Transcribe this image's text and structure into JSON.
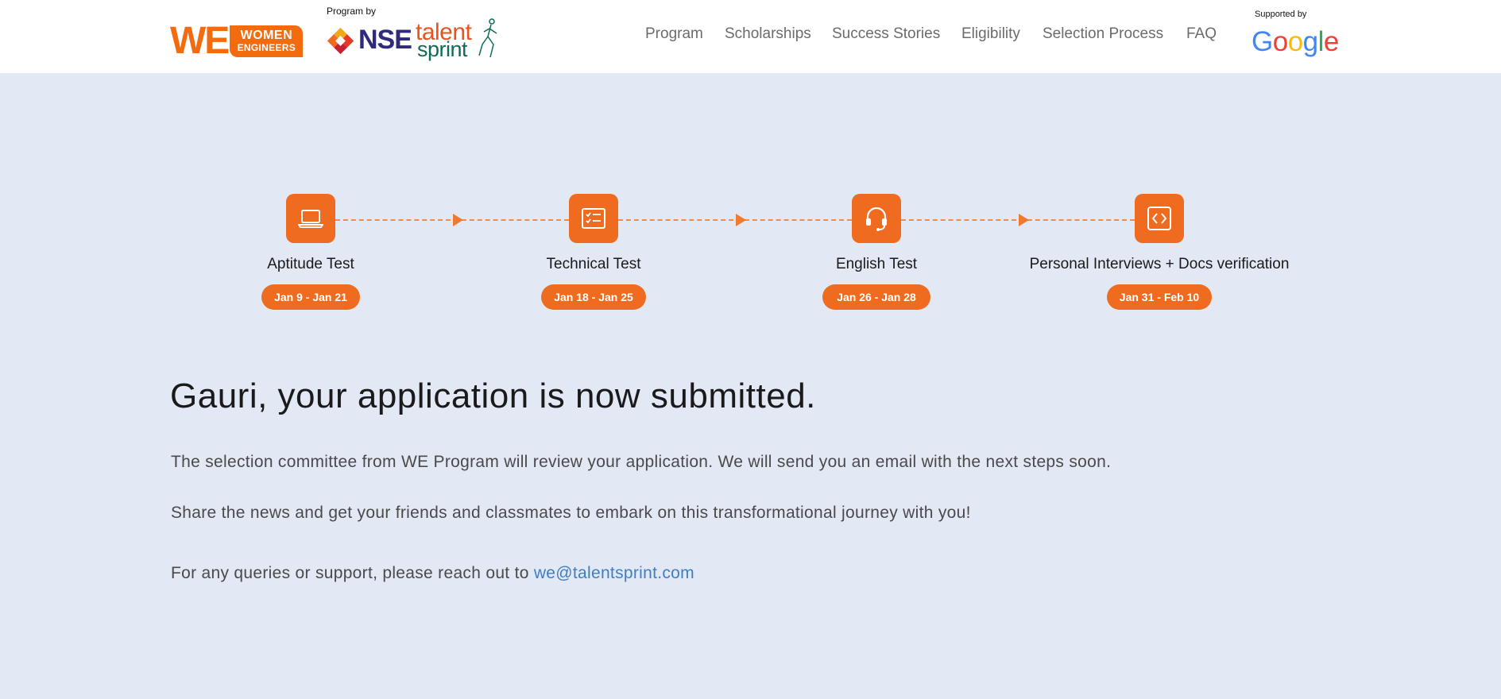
{
  "header": {
    "we_logo": {
      "we": "WE",
      "line1": "WOMEN",
      "line2": "ENGINEERS"
    },
    "program_by": "Program by",
    "nse_text": "NSE",
    "talentsprint": {
      "talent": "talent",
      "sprint": "sprint"
    },
    "nav": [
      "Program",
      "Scholarships",
      "Success Stories",
      "Eligibility",
      "Selection Process",
      "FAQ"
    ],
    "supported_by": "Supported by",
    "google": [
      "G",
      "o",
      "o",
      "g",
      "l",
      "e"
    ],
    "google_colors": [
      "#4285F4",
      "#EA4335",
      "#FBBC05",
      "#4285F4",
      "#34A853",
      "#EA4335"
    ]
  },
  "steps": [
    {
      "title": "Aptitude Test",
      "dates": "Jan 9 - Jan 21",
      "icon": "laptop-icon"
    },
    {
      "title": "Technical Test",
      "dates": "Jan 18 - Jan 25",
      "icon": "checklist-icon"
    },
    {
      "title": "English Test",
      "dates": "Jan 26 - Jan 28",
      "icon": "headset-icon"
    },
    {
      "title": "Personal Interviews + Docs verification",
      "dates": "Jan 31 - Feb 10",
      "icon": "code-icon"
    }
  ],
  "content": {
    "headline": "Gauri, your application is now submitted.",
    "paragraph1": "The selection committee from WE Program will review your application. We will send you an email with the next steps soon.",
    "paragraph2": "Share the news and get your friends and classmates to embark on this transformational journey with you!",
    "paragraph3_prefix": "For any queries or support, please reach out to ",
    "email": "we@talentsprint.com"
  },
  "colors": {
    "accent": "#ee6b1f",
    "background": "#e2e8f4",
    "link": "#3f7ec4",
    "nse_purple": "#2e2a7d",
    "sprint_green": "#0f6b58"
  }
}
